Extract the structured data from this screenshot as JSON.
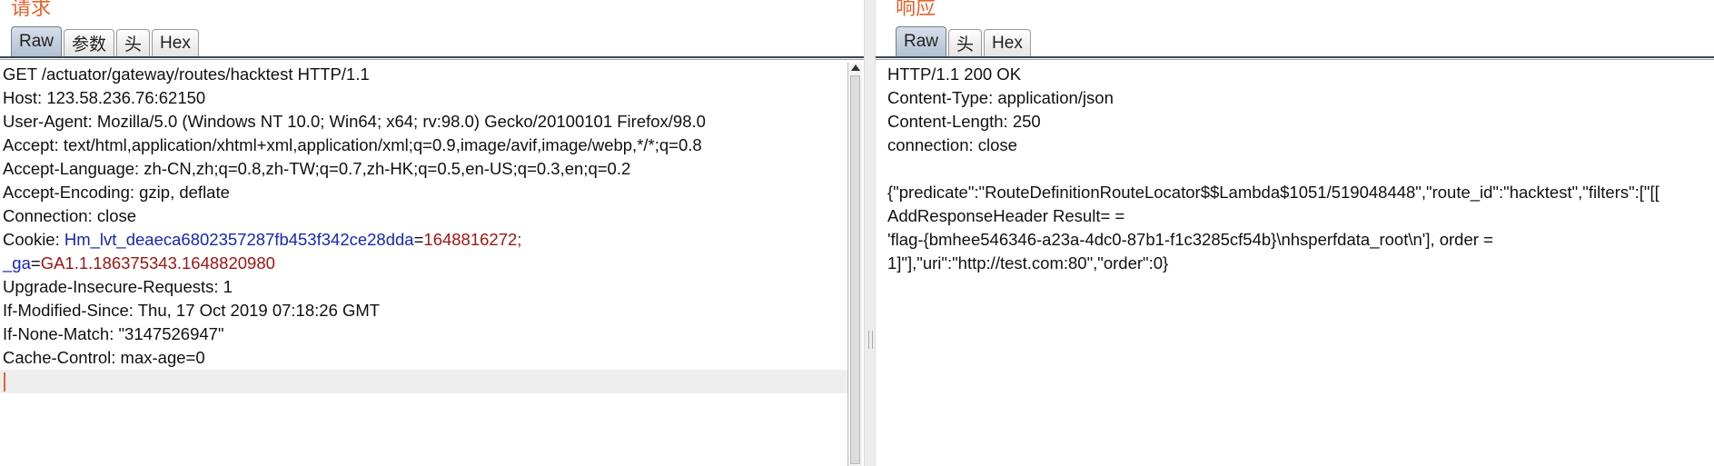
{
  "request": {
    "title": "请求",
    "tabs": [
      "Raw",
      "参数",
      "头",
      "Hex"
    ],
    "lines": [
      "GET /actuator/gateway/routes/hacktest HTTP/1.1",
      "Host: 123.58.236.76:62150",
      "User-Agent: Mozilla/5.0 (Windows NT 10.0; Win64; x64; rv:98.0) Gecko/20100101 Firefox/98.0",
      "Accept: text/html,application/xhtml+xml,application/xml;q=0.9,image/avif,image/webp,*/*;q=0.8",
      "Accept-Language: zh-CN,zh;q=0.8,zh-TW;q=0.7,zh-HK;q=0.5,en-US;q=0.3,en;q=0.2",
      "Accept-Encoding: gzip, deflate",
      "Connection: close"
    ],
    "cookie": {
      "label": "Cookie: ",
      "name1": "Hm_lvt_deaeca6802357287fb453f342ce28dda",
      "eq": "=",
      "value1": "1648816272",
      "sep": ";",
      "name2": "_ga",
      "value2": "GA1.1.186375343.1648820980"
    },
    "lines_after": [
      "Upgrade-Insecure-Requests: 1",
      "If-Modified-Since: Thu, 17 Oct 2019 07:18:26 GMT",
      "If-None-Match: \"3147526947\"",
      "Cache-Control: max-age=0"
    ]
  },
  "response": {
    "title": "响应",
    "tabs": [
      "Raw",
      "头",
      "Hex"
    ],
    "lines": [
      "HTTP/1.1 200 OK",
      "Content-Type: application/json",
      "Content-Length: 250",
      "connection: close",
      "",
      "{\"predicate\":\"RouteDefinitionRouteLocator$$Lambda$1051/519048448\",\"route_id\":\"hacktest\",\"filters\":[\"[[",
      "AddResponseHeader Result= =",
      "'flag-{bmhee546346-a23a-4dc0-87b1-f1c3285cf54b}\\nhsperfdata_root\\n'], order =",
      "1]\"],\"uri\":\"http://test.com:80\",\"order\":0}"
    ]
  }
}
